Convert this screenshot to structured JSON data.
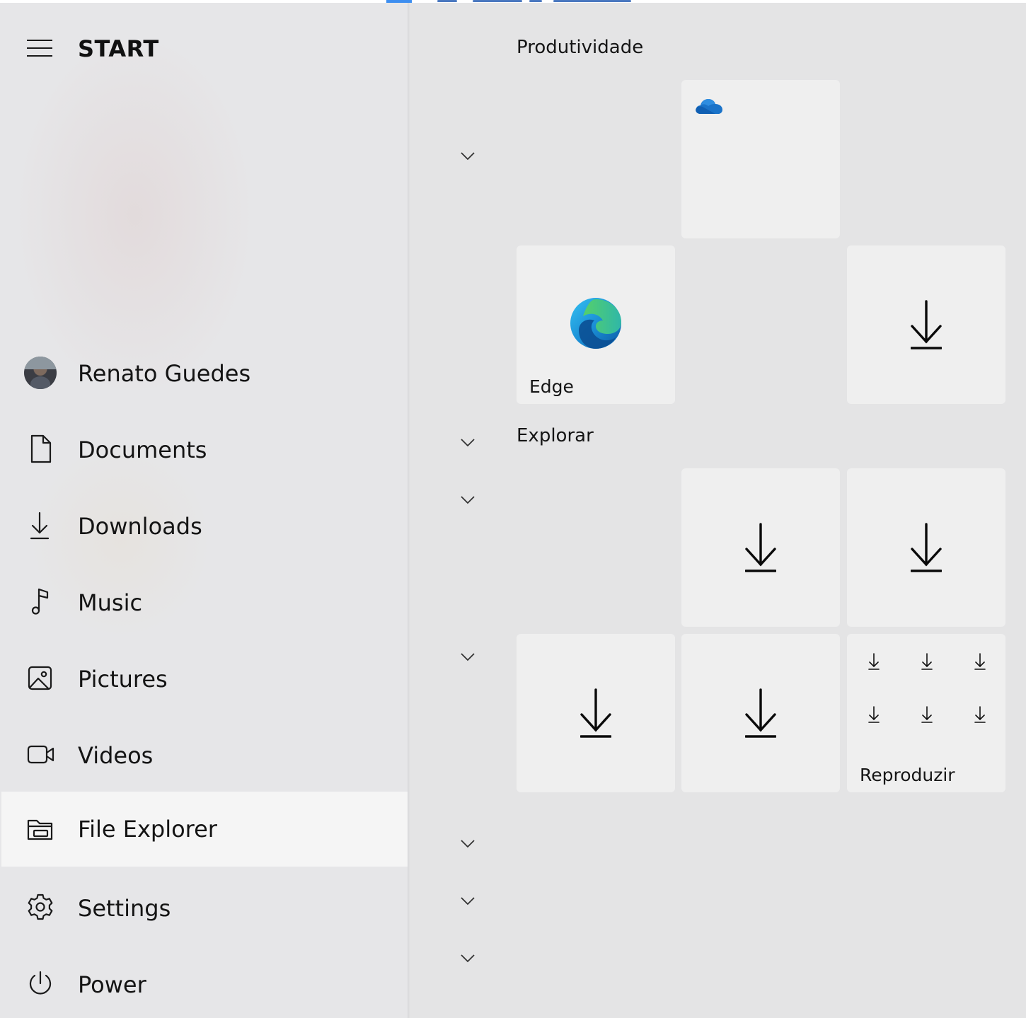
{
  "start": {
    "title": "START"
  },
  "nav": {
    "user": "Renato Guedes",
    "items": [
      {
        "label": "Documents",
        "icon": "document-icon"
      },
      {
        "label": "Downloads",
        "icon": "download-icon"
      },
      {
        "label": "Music",
        "icon": "music-note-icon"
      },
      {
        "label": "Pictures",
        "icon": "picture-icon"
      },
      {
        "label": "Videos",
        "icon": "video-camera-icon"
      },
      {
        "label": "File Explorer",
        "icon": "folder-icon"
      },
      {
        "label": "Settings",
        "icon": "gear-icon"
      },
      {
        "label": "Power",
        "icon": "power-icon"
      }
    ],
    "active": "File Explorer"
  },
  "groups": {
    "productivity": "Produtividade",
    "explore": "Explorar"
  },
  "tiles": {
    "onedrive": {
      "label": "",
      "icon": "onedrive-cloud-icon"
    },
    "edge": {
      "label": "Edge",
      "icon": "edge-browser-icon"
    },
    "play": {
      "label": "Reproduzir"
    }
  },
  "colors": {
    "onedrive": "#1a73c9",
    "active_background": "#f5f5f5"
  }
}
